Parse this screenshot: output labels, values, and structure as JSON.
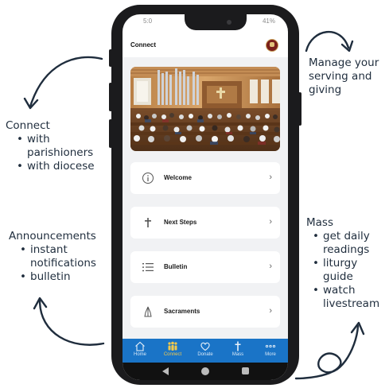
{
  "annotations": {
    "connect": {
      "title": "Connect",
      "items": [
        "with parishioners",
        "with diocese"
      ]
    },
    "manage": {
      "text": "Manage your serving and giving"
    },
    "announcements": {
      "title": "Announcements",
      "items": [
        "instant notifications",
        "bulletin"
      ]
    },
    "mass": {
      "title": "Mass",
      "items": [
        "get daily readings",
        "liturgy guide",
        "watch livestream"
      ]
    }
  },
  "status_bar": {
    "time": "5:0",
    "battery": "41%"
  },
  "app_bar": {
    "title": "Connect",
    "avatar_icon": "parish-logo-icon"
  },
  "hero_image": {
    "description_icon": "church-interior-photo"
  },
  "menu": [
    {
      "label": "Welcome",
      "icon": "info-circle-icon"
    },
    {
      "label": "Next Steps",
      "icon": "cross-icon"
    },
    {
      "label": "Bulletin",
      "icon": "list-icon"
    },
    {
      "label": "Sacraments",
      "icon": "praying-hands-icon"
    }
  ],
  "tabs": [
    {
      "label": "Home",
      "icon": "home-icon",
      "active": false
    },
    {
      "label": "Connect",
      "icon": "people-icon",
      "active": true
    },
    {
      "label": "Donate",
      "icon": "heart-icon",
      "active": false
    },
    {
      "label": "Mass",
      "icon": "cross-icon",
      "active": false
    },
    {
      "label": "More",
      "icon": "more-icon",
      "active": false
    }
  ],
  "colors": {
    "accent": "#1a74c7",
    "active_tab": "#f2c94c",
    "ink": "#1f2d3d"
  }
}
